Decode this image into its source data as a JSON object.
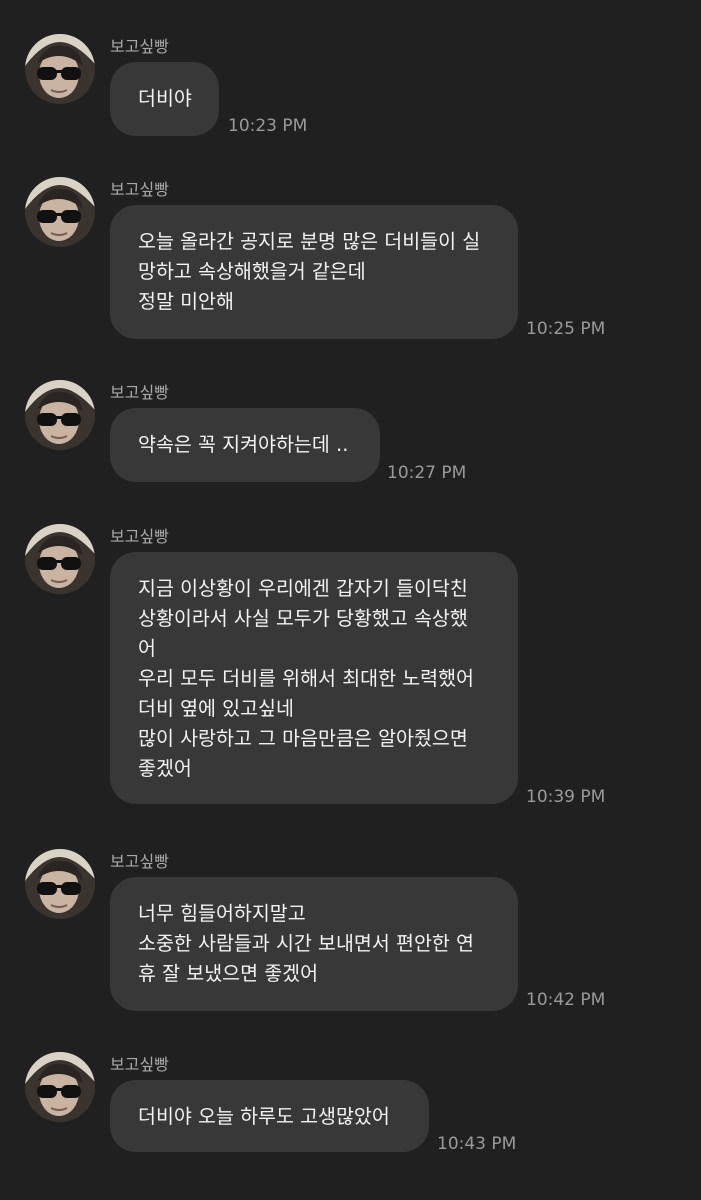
{
  "chat": {
    "messages": [
      {
        "sender": "보고싶빵",
        "lines": [
          "더비야"
        ],
        "time": "10:23 PM"
      },
      {
        "sender": "보고싶빵",
        "lines": [
          "오늘 올라간 공지로 분명 많은 더비들이 실",
          "망하고 속상해했을거 같은데",
          "정말 미안해"
        ],
        "time": "10:25 PM"
      },
      {
        "sender": "보고싶빵",
        "lines": [
          "약속은 꼭 지켜야하는데 .."
        ],
        "time": "10:27 PM"
      },
      {
        "sender": "보고싶빵",
        "lines": [
          "지금 이상황이 우리에겐 갑자기 들이닥친",
          "상황이라서 사실 모두가 당황했고 속상했",
          "어",
          "우리 모두 더비를 위해서 최대한 노력했어",
          "더비 옆에 있고싶네",
          "많이 사랑하고 그 마음만큼은 알아줬으면",
          "좋겠어"
        ],
        "time": "10:39 PM"
      },
      {
        "sender": "보고싶빵",
        "lines": [
          "너무 힘들어하지말고",
          "소중한 사람들과 시간 보내면서 편안한 연",
          "휴 잘 보냈으면 좋겠어"
        ],
        "time": "10:42 PM"
      },
      {
        "sender": "보고싶빵",
        "lines": [
          "더비야 오늘 하루도 고생많았어"
        ],
        "time": "10:43 PM"
      }
    ]
  },
  "colors": {
    "background": "#202020",
    "bubble": "#383838",
    "text": "#f2f2f2",
    "meta": "#9a9a9a"
  },
  "icons": {
    "avatar": "profile-photo-avatar"
  }
}
